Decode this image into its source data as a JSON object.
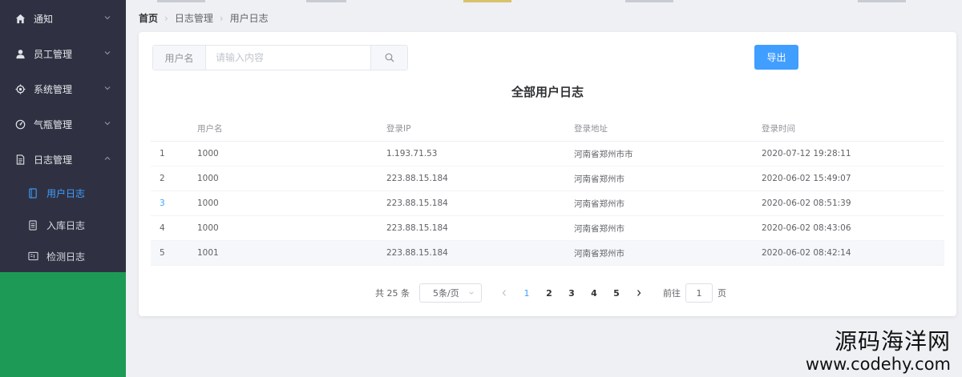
{
  "sidebar": {
    "items": [
      {
        "label": "通知",
        "icon": "home-icon",
        "expanded": false
      },
      {
        "label": "员工管理",
        "icon": "user-icon",
        "expanded": false
      },
      {
        "label": "系统管理",
        "icon": "gear-icon",
        "expanded": false
      },
      {
        "label": "气瓶管理",
        "icon": "gauge-icon",
        "expanded": false
      },
      {
        "label": "日志管理",
        "icon": "document-icon",
        "expanded": true
      }
    ],
    "subitems": [
      {
        "label": "用户日志",
        "icon": "page-icon",
        "active": true
      },
      {
        "label": "入库日志",
        "icon": "list-icon",
        "active": false
      },
      {
        "label": "检测日志",
        "icon": "panel-icon",
        "active": false
      }
    ]
  },
  "breadcrumb": [
    "首页",
    "日志管理",
    "用户日志"
  ],
  "search": {
    "label": "用户名",
    "placeholder": "请输入内容",
    "value": ""
  },
  "toolbar": {
    "export_label": "导出"
  },
  "table": {
    "title": "全部用户日志",
    "headers": [
      "",
      "用户名",
      "登录IP",
      "登录地址",
      "登录时间"
    ],
    "rows": [
      {
        "index": "1",
        "username": "1000",
        "ip": "1.193.71.53",
        "address": "河南省郑州市市",
        "time": "2020-07-12 19:28:11"
      },
      {
        "index": "2",
        "username": "1000",
        "ip": "223.88.15.184",
        "address": "河南省郑州市",
        "time": "2020-06-02 15:49:07"
      },
      {
        "index": "3",
        "username": "1000",
        "ip": "223.88.15.184",
        "address": "河南省郑州市",
        "time": "2020-06-02 08:51:39"
      },
      {
        "index": "4",
        "username": "1000",
        "ip": "223.88.15.184",
        "address": "河南省郑州市",
        "time": "2020-06-02 08:43:06"
      },
      {
        "index": "5",
        "username": "1001",
        "ip": "223.88.15.184",
        "address": "河南省郑州市",
        "time": "2020-06-02 08:42:14"
      }
    ]
  },
  "pagination": {
    "total_label": "共 25 条",
    "page_size": "5条/页",
    "pages": [
      "1",
      "2",
      "3",
      "4",
      "5"
    ],
    "current": "1",
    "goto_label": "前往",
    "goto_value": "1",
    "page_suffix": "页"
  },
  "watermark": {
    "cn": "源码海洋网",
    "url": "www.codehy.com"
  },
  "colors": {
    "sidebar_bg": "#2f3142",
    "sidebar_green": "#1d9a55",
    "accent": "#409eff",
    "page_bg": "#eef0f3"
  }
}
